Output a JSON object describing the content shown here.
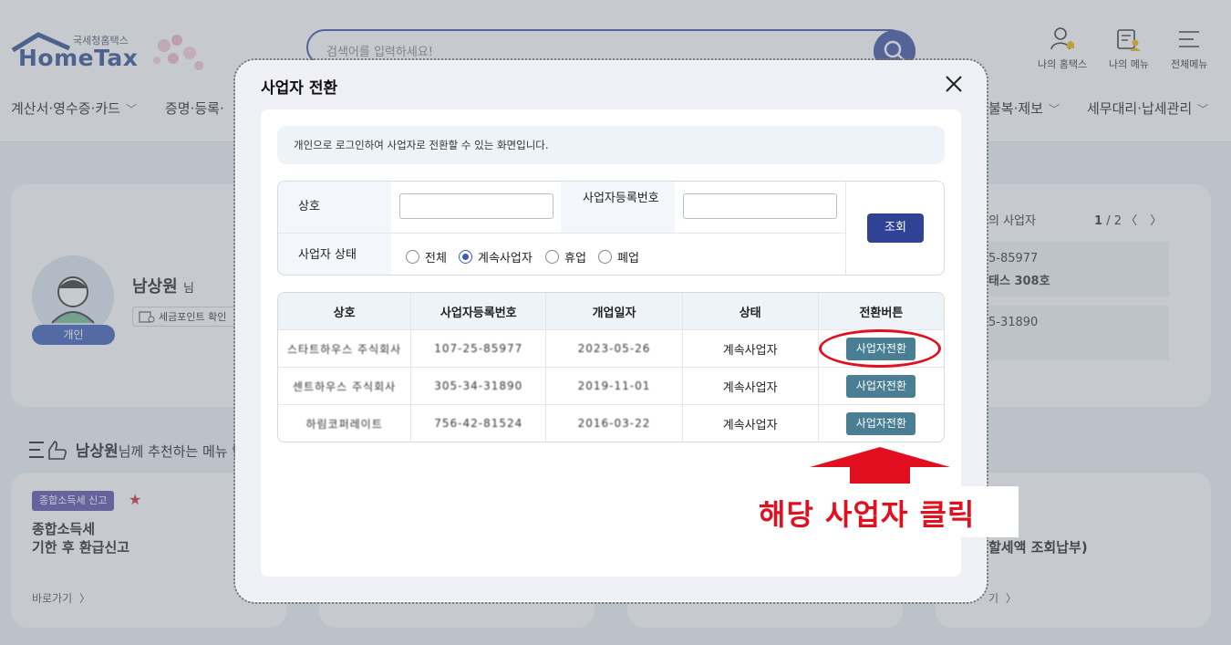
{
  "header": {
    "logo_sub": "국세청홈택스",
    "logo_main": "HomeTax",
    "search_placeholder": "검색어를 입력하세요!",
    "tools": [
      "나의 홈택스",
      "나의 메뉴",
      "전체메뉴"
    ],
    "nav": [
      "계산서·영수증·카드",
      "증명·등록·",
      "불복·제보",
      "세무대리·납세관리"
    ]
  },
  "profile": {
    "name": "남상원",
    "suffix": "님",
    "badge": "개인",
    "point_button": "세금포인트 확인"
  },
  "recommend": {
    "name": "남상원",
    "title_rest": "님께 추천하는 메뉴 입",
    "tag": "종합소득세 신고",
    "card_title_line1": "종합소득세",
    "card_title_line2": "기한 후 환급신고",
    "goto": "바로가기",
    "goto_right": "기",
    "right_card_title": "할세액 조회납부)"
  },
  "right_panel": {
    "title": "의 사업자",
    "pager_current": "1",
    "pager_total": "/ 2",
    "item1_line1": "5-85977",
    "item1_line2": "태스 308호",
    "item2_line1": "5-31890"
  },
  "modal": {
    "title": "사업자 전환",
    "notice": "개인으로 로그인하여 사업자로 전환할 수 있는 화면입니다.",
    "form": {
      "label_name": "상호",
      "label_regno": "사업자등록번호",
      "label_status": "사업자 상태",
      "radios": [
        "전체",
        "계속사업자",
        "휴업",
        "폐업"
      ],
      "selected": "계속사업자",
      "query_button": "조회"
    },
    "table": {
      "headers": [
        "상호",
        "사업자등록번호",
        "개업일자",
        "상태",
        "전환버튼"
      ],
      "rows": [
        {
          "name": "스타트하우스 주식회사",
          "regno": "107-25-85977",
          "date": "2023-05-26",
          "status": "계속사업자",
          "button": "사업자전환"
        },
        {
          "name": "센트하우스 주식회사",
          "regno": "305-34-31890",
          "date": "2019-11-01",
          "status": "계속사업자",
          "button": "사업자전환"
        },
        {
          "name": "하림코퍼레이트",
          "regno": "756-42-81524",
          "date": "2016-03-22",
          "status": "계속사업자",
          "button": "사업자전환"
        }
      ]
    }
  },
  "annotation": {
    "text": "해당 사업자 클릭",
    "color": "#e10f1f"
  }
}
